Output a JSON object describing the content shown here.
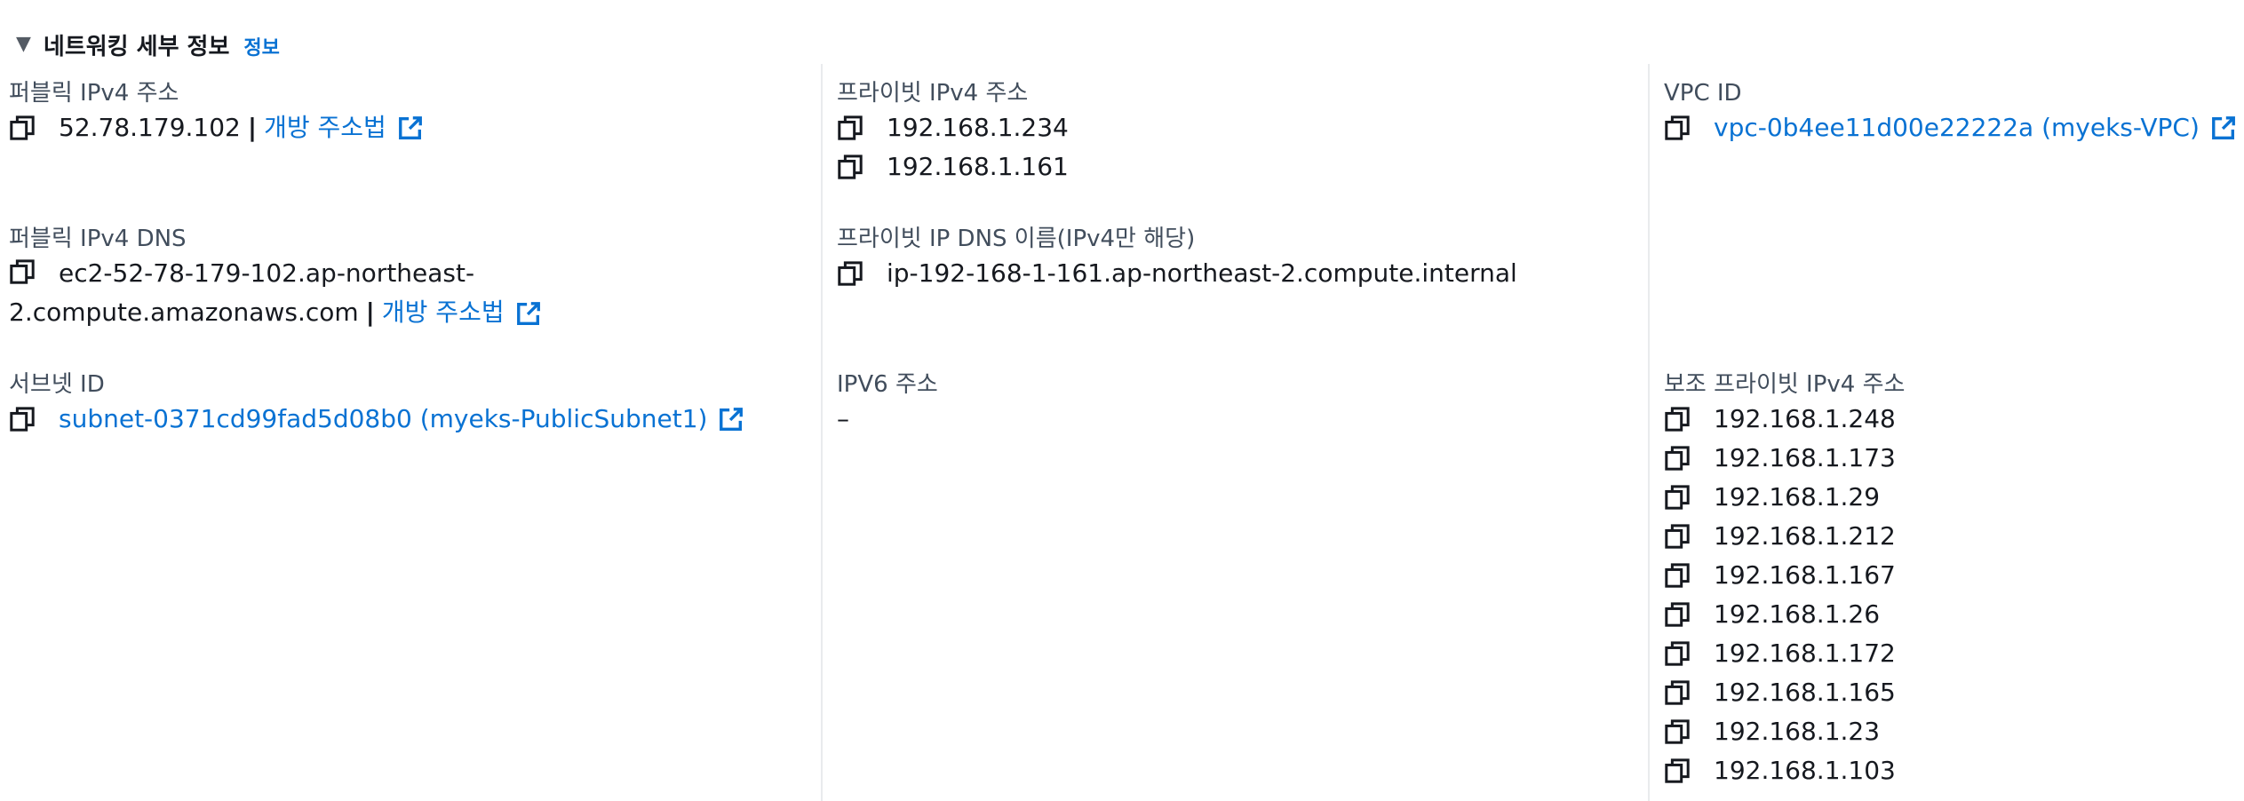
{
  "section": {
    "title": "네트워킹 세부 정보",
    "info_link": "정보"
  },
  "col1": {
    "public_ipv4": {
      "label": "퍼블릭 IPv4 주소",
      "value": "52.78.179.102",
      "separator": "|",
      "open_link": "개방 주소법"
    },
    "public_dns": {
      "label": "퍼블릭 IPv4 DNS",
      "value": "ec2-52-78-179-102.ap-northeast-2.compute.amazonaws.com",
      "separator": "|",
      "open_link": "개방 주소법"
    },
    "subnet": {
      "label": "서브넷 ID",
      "value": "subnet-0371cd99fad5d08b0 (myeks-PublicSubnet1)"
    }
  },
  "col2": {
    "private_ipv4": {
      "label": "프라이빗 IPv4 주소",
      "values": [
        "192.168.1.234",
        "192.168.1.161"
      ]
    },
    "private_dns": {
      "label": "프라이빗 IP DNS 이름(IPv4만 해당)",
      "value": "ip-192-168-1-161.ap-northeast-2.compute.internal"
    },
    "ipv6": {
      "label": "IPV6 주소",
      "value": "–"
    }
  },
  "col3": {
    "vpc": {
      "label": "VPC ID",
      "value": "vpc-0b4ee11d00e22222a (myeks-VPC)"
    },
    "secondary_private_ipv4": {
      "label": "보조 프라이빗 IPv4 주소",
      "values": [
        "192.168.1.248",
        "192.168.1.173",
        "192.168.1.29",
        "192.168.1.212",
        "192.168.1.167",
        "192.168.1.26",
        "192.168.1.172",
        "192.168.1.165",
        "192.168.1.23",
        "192.168.1.103"
      ]
    }
  },
  "icons": {
    "copy": "copy-icon",
    "external": "external-link-icon",
    "caret": "caret-down-icon"
  },
  "colors": {
    "link": "#0972d3",
    "text": "#16191f",
    "label": "#414d5c",
    "divider": "#e9ebed"
  }
}
